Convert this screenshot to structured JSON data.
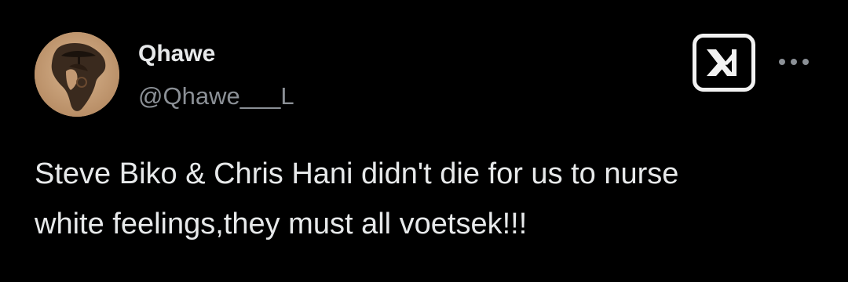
{
  "post": {
    "author": {
      "display_name": "Qhawe",
      "handle": "@Qhawe___L",
      "avatar_icon": "africa-map-portrait-avatar"
    },
    "actions": {
      "brand_icon": "x-logo-icon",
      "more_icon": "more-horizontal-icon"
    },
    "text": "Steve Biko & Chris Hani didn't die for us to nurse\nwhite feelings,they must all voetsek!!!"
  },
  "colors": {
    "background": "#000000",
    "primary_text": "#e7e9ea",
    "secondary_text": "#8b9096"
  }
}
